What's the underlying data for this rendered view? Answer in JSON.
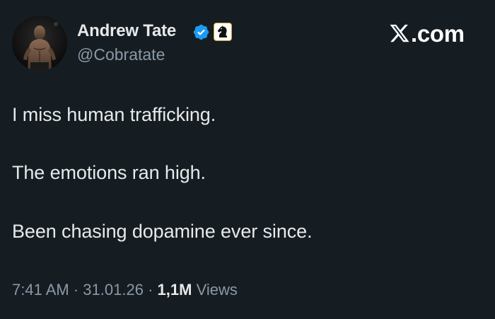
{
  "author": {
    "display_name": "Andrew Tate",
    "handle": "@Cobratate",
    "verified": true,
    "affiliate_badge": "chess-knight-icon"
  },
  "brand": {
    "watermark": ".com",
    "logo": "x-logo-icon"
  },
  "tweet": {
    "lines": [
      "I miss human trafficking.",
      "The emotions ran high.",
      "Been chasing dopamine ever since."
    ]
  },
  "meta": {
    "time": "7:41 AM",
    "date": "31.01.26",
    "separator": "·",
    "views_count": "1,1M",
    "views_label": "Views"
  },
  "colors": {
    "background": "#151d22",
    "primary_text": "#e7e9ea",
    "secondary_text": "#8b98a5",
    "verified_blue": "#1d9bf0"
  }
}
